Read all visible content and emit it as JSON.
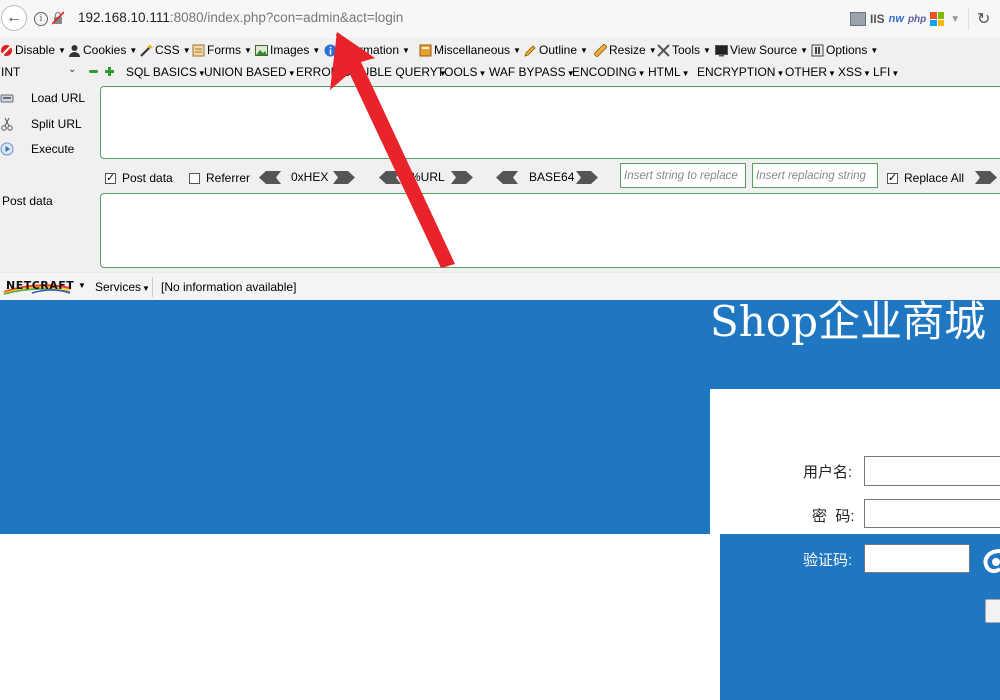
{
  "address_bar": {
    "host": "192.168.10.111",
    "path": ":8080/index.php?con=admin&act=login",
    "iis_label": "IIS",
    "nw_label": "nw",
    "php_label": "php"
  },
  "hackbar": {
    "menu": [
      {
        "label": "Disable",
        "icon": "block-icon"
      },
      {
        "label": "Cookies",
        "icon": "user-icon"
      },
      {
        "label": "CSS",
        "icon": "wand-icon"
      },
      {
        "label": "Forms",
        "icon": "forms-icon"
      },
      {
        "label": "Images",
        "icon": "image-icon"
      },
      {
        "label": "Information",
        "icon": "info-icon"
      },
      {
        "label": "Miscellaneous",
        "icon": "misc-icon"
      },
      {
        "label": "Outline",
        "icon": "pencil-icon"
      },
      {
        "label": "Resize",
        "icon": "ruler-icon"
      },
      {
        "label": "Tools",
        "icon": "tools-icon"
      },
      {
        "label": "View Source",
        "icon": "monitor-icon"
      },
      {
        "label": "Options",
        "icon": "options-icon"
      }
    ],
    "int_select": "INT",
    "submenu": [
      "SQL BASICS",
      "UNION BASED",
      "ERROR/DOUBLE QUERY",
      "TOOLS",
      "WAF BYPASS",
      "ENCODING",
      "HTML",
      "ENCRYPTION",
      "OTHER",
      "XSS",
      "LFI"
    ],
    "side_buttons": [
      "Load URL",
      "Split URL",
      "Execute"
    ],
    "options": {
      "post_data": "Post data",
      "post_data_checked": true,
      "referrer": "Referrer",
      "referrer_checked": false,
      "hex": "0xHEX",
      "url": "%URL",
      "base64": "BASE64",
      "replace_placeholder": "Insert string to replace",
      "replacing_placeholder": "Insert replacing string",
      "replace_all": "Replace All",
      "replace_all_checked": true
    },
    "post_data_label": "Post data"
  },
  "netcraft": {
    "logo": "NETCRAFT",
    "services": "Services",
    "info": "[No information available]"
  },
  "page": {
    "title": "Shop企业商城",
    "username_label": "用户名:",
    "password_label": "密  码:",
    "captcha_label": "验证码:"
  },
  "colors": {
    "brand_blue": "#1f77c2",
    "annotation_red": "#e8232a",
    "hackbar_border": "#5aa05a"
  }
}
